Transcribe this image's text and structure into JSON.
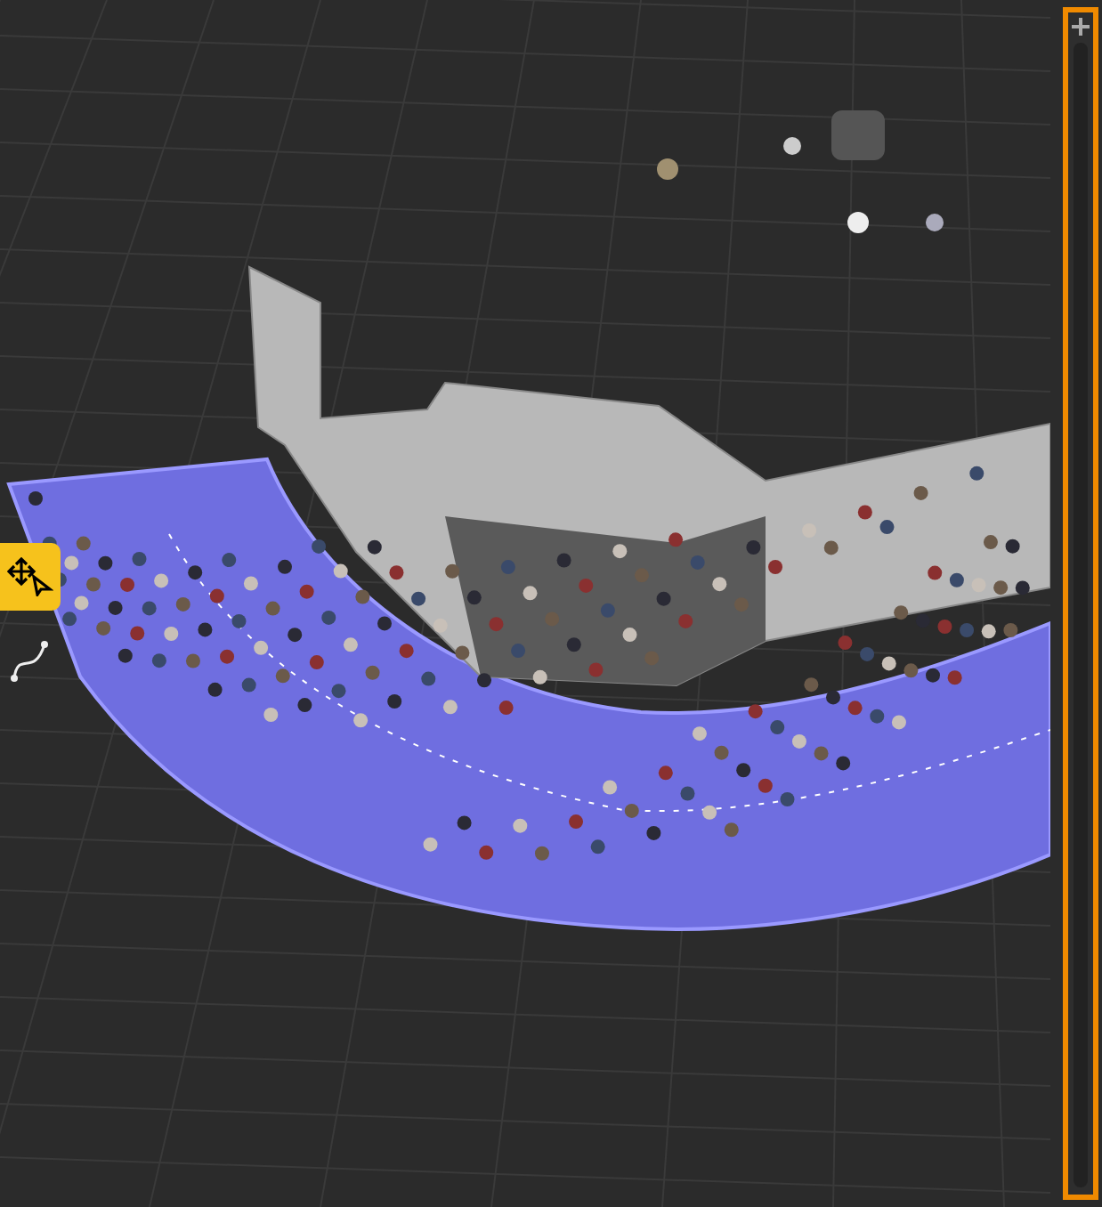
{
  "tools": [
    {
      "kind": "move",
      "selected": true
    },
    {
      "kind": "curve",
      "selected": false
    }
  ],
  "side_panel": {
    "highlighted": true
  }
}
